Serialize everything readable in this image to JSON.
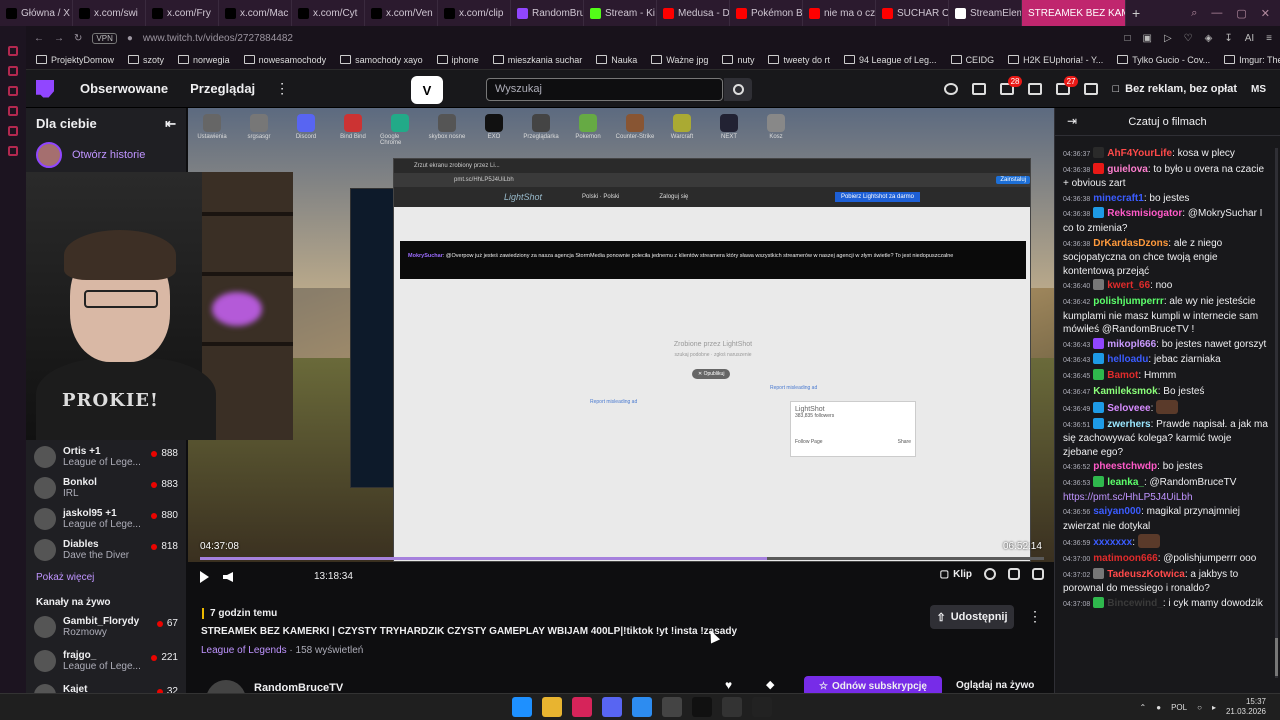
{
  "browser": {
    "tabs": [
      {
        "label": "Główna / X",
        "color": "#000000"
      },
      {
        "label": "x.com/swi",
        "color": "#000000"
      },
      {
        "label": "x.com/Fry",
        "color": "#000000"
      },
      {
        "label": "x.com/Mac",
        "color": "#000000"
      },
      {
        "label": "x.com/Cyt",
        "color": "#000000"
      },
      {
        "label": "x.com/Ven",
        "color": "#000000"
      },
      {
        "label": "x.com/clip",
        "color": "#000000"
      },
      {
        "label": "RandomBru",
        "color": "#9146ff"
      },
      {
        "label": "Stream - Ki",
        "color": "#53fc18"
      },
      {
        "label": "Medusa - D",
        "color": "#ff0000"
      },
      {
        "label": "Pokémon B",
        "color": "#ff0000"
      },
      {
        "label": "nie ma o cz",
        "color": "#ff0000"
      },
      {
        "label": "SUCHAR O",
        "color": "#ff0000"
      },
      {
        "label": "StreamElem",
        "color": "#ffffff"
      }
    ],
    "active_tab": "STREAMEK BEZ KAM",
    "url": "www.twitch.tv/videos/2727884482",
    "vpn_label": "VPN",
    "ai_label": "AI",
    "bookmarks": [
      "ProjektyDomow",
      "szoty",
      "norwegia",
      "nowesamochody",
      "samochody xayo",
      "iphone",
      "mieszkania suchar",
      "Nauka",
      "Ważne jpg",
      "nuty",
      "tweety do rt",
      "94 League of Leg...",
      "CEIDG",
      "H2K EUphoria! - Y...",
      "Tylko Gucio - Cov...",
      "Imgur: The most a..."
    ]
  },
  "twitch_nav": {
    "following": "Obserwowane",
    "browse": "Przeglądaj",
    "search_placeholder": "Wyszukaj",
    "badge_1": "28",
    "badge_2": "27",
    "no_ads": "Bez reklam, bez opłat",
    "avatar_initials": "MS"
  },
  "sidebar": {
    "header": "Dla ciebie",
    "story_label": "Otwórz historie",
    "channels": [
      {
        "name": "Ortis +1",
        "game": "League of Lege...",
        "viewers": "888"
      },
      {
        "name": "Bonkol",
        "game": "IRL",
        "viewers": "883"
      },
      {
        "name": "jaskol95 +1",
        "game": "League of Lege...",
        "viewers": "880"
      },
      {
        "name": "Diables",
        "game": "Dave the Diver",
        "viewers": "818"
      }
    ],
    "show_more": "Pokaż więcej",
    "live_header": "Kanały na żywo",
    "live_channels": [
      {
        "name": "Gambit_Florydy",
        "game": "Rozmowy",
        "viewers": "67"
      },
      {
        "name": "frajgo_",
        "game": "League of Lege...",
        "viewers": "221"
      },
      {
        "name": "Kajet_",
        "game": "",
        "viewers": "32"
      }
    ]
  },
  "webcam": {
    "hoodie_text": "PROKIE!"
  },
  "video": {
    "elapsed": "04:37:08",
    "duration": "06:52:14",
    "progress_fraction": 0.672,
    "current_time": "13:18:34",
    "clip_label": "Klip",
    "desktop_icons": [
      "Ustawienia",
      "srgsasgr",
      "Discord",
      "Bind Bind",
      "Google Chrome",
      "skybox nosne",
      "EXO",
      "Przeglądarka",
      "Pokemon",
      "Counter-Strike",
      "Warcraft",
      "NEXT",
      "Kosz"
    ],
    "shot": {
      "tab_title": "Zrzut ekranu zrobiony przez Li...",
      "url": "pmt.sc/HhLP5J4UiLbh",
      "install_btn": "Zainstaluj",
      "lightshot_logo": "LightShot",
      "lang_label": "Polski · Polski",
      "login_label": "Zaloguj się",
      "download_btn": "Pobierz Lightshot za darmo",
      "message_user": "MokrySuchar",
      "message_text": "@Overpow już jesteś zawiedziony za nasza agencja StormMedia ponownie poleciła jednemu z klientów streamera który sława wszystkich streamerów w naszej agencji w złym świetle? To jest niedopuszczalne",
      "made_by": "Zrobione przez LightShot",
      "made_by_sub": "szukaj podobne · zgłoś naruszenie",
      "share_btn": "✕ Opublikuj",
      "report_left": "Report misleading ad",
      "report_right": "Report misleading ad",
      "card_title": "LightShot",
      "card_followers": "383,835 followers",
      "card_follow": "Follow Page",
      "card_share": "Share"
    }
  },
  "info": {
    "ago": "7 godzin temu",
    "title": "STREAMEK BEZ KAMERKI | CZYSTY TRYHARDZIK CZYSTY GAMEPLAY WBIJAM 400LP|!tiktok !yt !insta !zasady",
    "game": "League of Legends",
    "views": " · 158 wyświetleń",
    "share": "Udostępnij",
    "channel": "RandomBruceTV",
    "subscribe": "Odnów subskrypcję",
    "watch_live": "Oglądaj na żywo"
  },
  "chat": {
    "header": "Czatuj o filmach",
    "messages": [
      {
        "time": "04:36:37",
        "user": "AhF4YourLife",
        "color": "#ff4a4a",
        "text": "kosa w plecy",
        "badge": "#2a2a2a"
      },
      {
        "time": "04:36:38",
        "user": "guielova",
        "color": "#ff7fd0",
        "text": "to było u overa na czacie + obvious zart",
        "badge": "#e91916"
      },
      {
        "time": "04:36:38",
        "user": "minecraft1",
        "color": "#3b5cff",
        "text": "bo jestes",
        "badge": ""
      },
      {
        "time": "04:36:38",
        "user": "Reksmisiogator",
        "color": "#ff5ac8",
        "text": "@MokrySuchar I co to zmienia?",
        "badge": "#1e9be6"
      },
      {
        "time": "04:36:38",
        "user": "DrKardasDzons",
        "color": "#ff9a3c",
        "text": "ale z niego socjopatyczna on chce twoją engie kontentową przejąć",
        "badge": ""
      },
      {
        "time": "04:36:40",
        "user": "kwert_66",
        "color": "#e02b2b",
        "text": "noo",
        "badge": "#777777"
      },
      {
        "time": "04:36:42",
        "user": "polishjumperrr",
        "color": "#5cff6b",
        "text": "ale wy nie jesteście kumplami nie masz kumpli w internecie sam mówiłeś @RandomBruceTV !",
        "badge": ""
      },
      {
        "time": "04:36:43",
        "user": "mikopl666",
        "color": "#c99aff",
        "text": "bo jestes nawet gorszyt",
        "badge": "#9146ff"
      },
      {
        "time": "04:36:43",
        "user": "helloadu",
        "color": "#3b5cff",
        "text": "jebac ziarniaka",
        "badge": "#1e9be6"
      },
      {
        "time": "04:36:45",
        "user": "Bamot",
        "color": "#e02b2b",
        "text": "Hmmm",
        "badge": "#2fb84d"
      },
      {
        "time": "04:36:47",
        "user": "Kamileksmok",
        "color": "#8bff7a",
        "text": "Bo jesteś",
        "badge": ""
      },
      {
        "time": "04:36:49",
        "user": "Seloveee",
        "color": "#d78cff",
        "text": "",
        "badge": "#1e9be6"
      },
      {
        "time": "04:36:51",
        "user": "zwerhers",
        "color": "#9be7ff",
        "text": "Prawde napisał. a jak ma się zachowywać kolega? karmić twoje zjebane ego?",
        "badge": "#1e9be6"
      },
      {
        "time": "04:36:52",
        "user": "pheestchwdp",
        "color": "#ff5ac8",
        "text": "bo jestes",
        "badge": ""
      },
      {
        "time": "04:36:53",
        "user": "leanka_",
        "color": "#5cff6b",
        "text": "@RandomBruceTV",
        "badge": "#2fb84d",
        "link": "https://pmt.sc/HhLP5J4UiLbh"
      },
      {
        "time": "04:36:56",
        "user": "saiyan000",
        "color": "#3b5cff",
        "text": "magikal przynajmniej zwierzat nie dotykal",
        "badge": ""
      },
      {
        "time": "04:36:59",
        "user": "xxxxxxx",
        "color": "#3b5cff",
        "text": "",
        "badge": ""
      },
      {
        "time": "04:37:00",
        "user": "matimoon666",
        "color": "#e02b2b",
        "text": "@polishjumperrr ooo",
        "badge": ""
      },
      {
        "time": "04:37:02",
        "user": "TadeuszKotwica",
        "color": "#ff4a4a",
        "text": "a jakbys to porownal do messiego i ronaldo?",
        "badge": "#777777"
      },
      {
        "time": "04:37:08",
        "user": "Bincewind_",
        "color": "#3a3a3a",
        "text": "i cyk mamy dowodzik",
        "badge": "#2fb84d"
      }
    ]
  },
  "taskbar": {
    "lang": "POL",
    "time": "15:37",
    "date": "21.03.2026"
  }
}
